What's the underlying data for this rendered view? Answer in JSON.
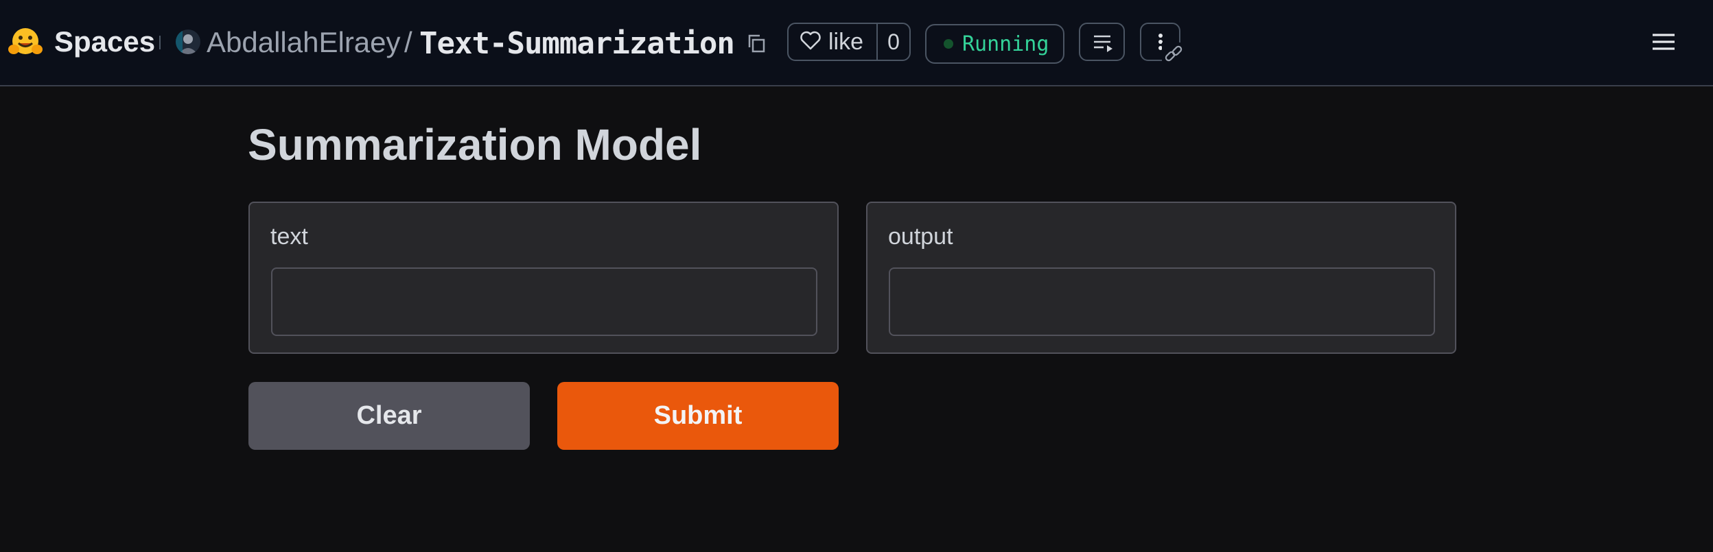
{
  "header": {
    "brand": "Spaces",
    "owner": "AbdallahElraey",
    "separator": "/",
    "repo": "Text-Summarization",
    "like_label": "like",
    "like_count": "0",
    "status": "Running",
    "status_color": "#34d399",
    "icons": [
      "hugging-face-logo",
      "copy-icon",
      "heart-icon",
      "logs-icon",
      "more-vertical-icon",
      "link-icon",
      "hamburger-menu-icon"
    ]
  },
  "app": {
    "title": "Summarization Model",
    "input": {
      "label": "text",
      "value": "",
      "placeholder": ""
    },
    "output": {
      "label": "output",
      "value": ""
    },
    "buttons": {
      "clear": "Clear",
      "submit": "Submit"
    },
    "accent_color": "#ea580c"
  }
}
